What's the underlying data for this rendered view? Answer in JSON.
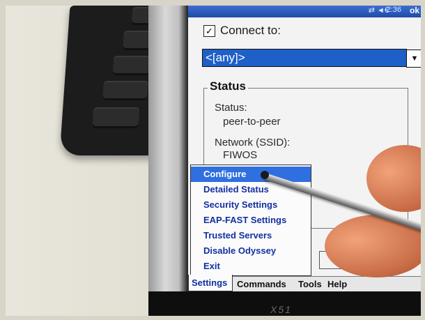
{
  "status_bar": {
    "icons": "⇄ ◄€",
    "time": "2:36",
    "ok_label": "ok"
  },
  "connect": {
    "checkbox_mark": "✓",
    "label": "Connect to:"
  },
  "network_dropdown": {
    "value": "<[any]>",
    "arrow": "▼"
  },
  "status_group": {
    "title": "Status",
    "status_label": "Status:",
    "status_value": "peer-to-peer",
    "network_label": "Network (SSID):",
    "network_value": "FIWOS"
  },
  "menu": {
    "items": [
      {
        "label": "Configure"
      },
      {
        "label": "Detailed Status"
      },
      {
        "label": "Security Settings"
      },
      {
        "label": "EAP-FAST Settings"
      },
      {
        "label": "Trusted Servers"
      },
      {
        "label": "Disable Odyssey"
      },
      {
        "label": "Exit"
      }
    ],
    "selected_index": 0
  },
  "command_bar": {
    "settings": "Settings",
    "commands": "Commands",
    "tools": "Tools",
    "help": "Help"
  },
  "device": {
    "model_label": "X51"
  },
  "colors": {
    "title_bar": "#1f4aa8",
    "selection": "#2f6fe0",
    "menu_text": "#1230a0"
  }
}
